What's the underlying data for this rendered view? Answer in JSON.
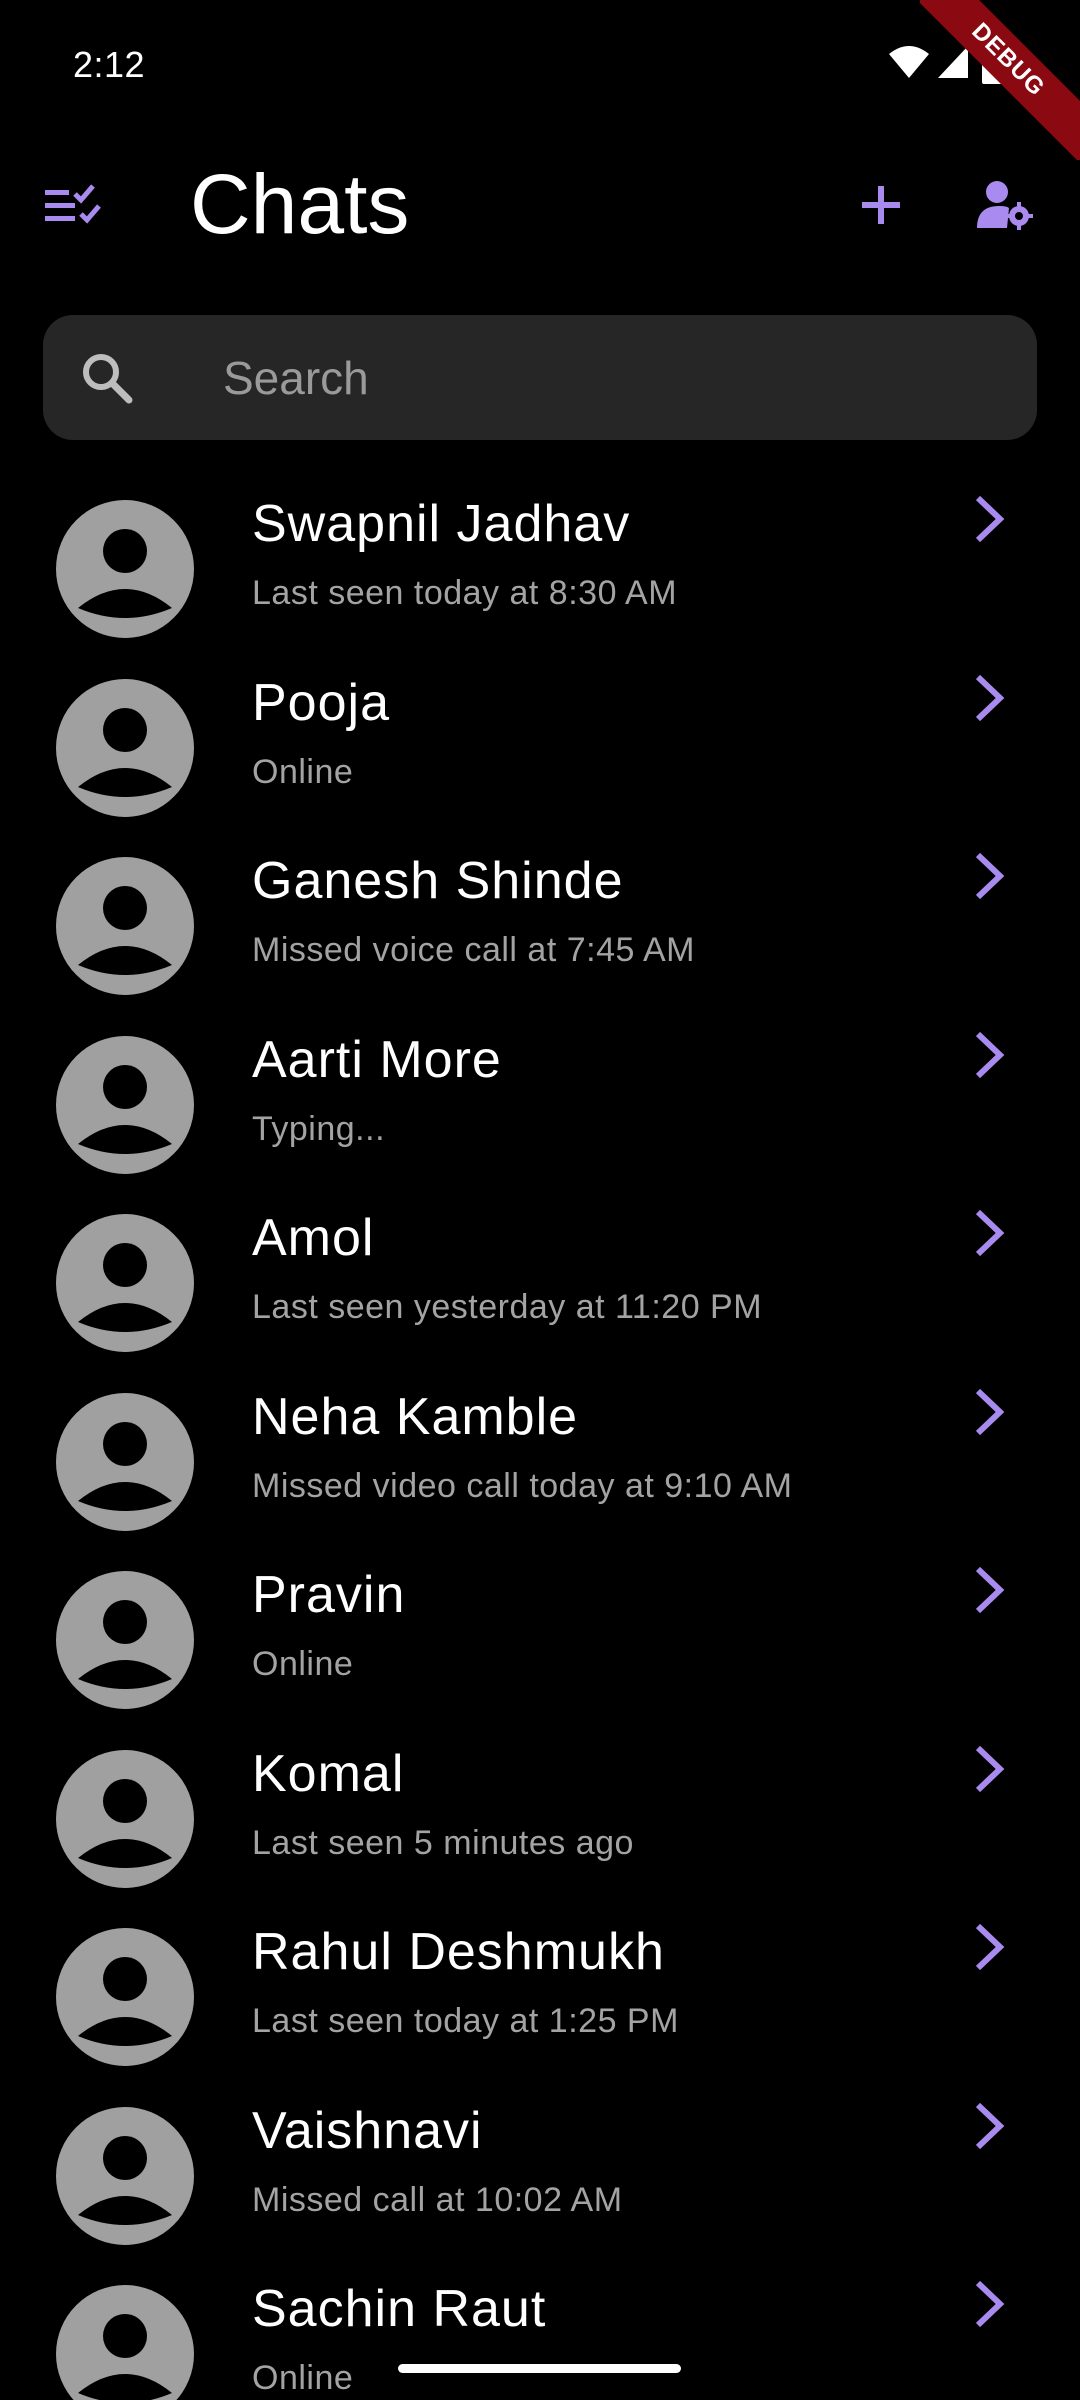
{
  "status_bar": {
    "time": "2:12"
  },
  "debug_banner": {
    "label": "DEBUG"
  },
  "app_bar": {
    "title": "Chats",
    "icons": [
      "checklist-icon",
      "add-icon",
      "manage-accounts-icon"
    ]
  },
  "search": {
    "placeholder": "Search",
    "value": ""
  },
  "colors": {
    "accent": "#a98bf0",
    "background": "#000000",
    "search_bg": "#262626",
    "avatar_gray": "#a0a0a0",
    "subtitle": "#a3a3a3",
    "debug_red": "#8b0a12"
  },
  "chats": [
    {
      "name": "Swapnil Jadhav",
      "status": "Last seen today at 8:30 AM"
    },
    {
      "name": "Pooja",
      "status": "Online"
    },
    {
      "name": "Ganesh Shinde",
      "status": "Missed voice call at 7:45 AM"
    },
    {
      "name": "Aarti More",
      "status": "Typing..."
    },
    {
      "name": "Amol",
      "status": "Last seen yesterday at 11:20 PM"
    },
    {
      "name": "Neha Kamble",
      "status": "Missed video call today at 9:10 AM"
    },
    {
      "name": "Pravin",
      "status": "Online"
    },
    {
      "name": "Komal",
      "status": "Last seen 5 minutes ago"
    },
    {
      "name": "Rahul Deshmukh",
      "status": "Last seen today at 1:25 PM"
    },
    {
      "name": "Vaishnavi",
      "status": "Missed call at 10:02 AM"
    },
    {
      "name": "Sachin Raut",
      "status": "Online"
    }
  ]
}
